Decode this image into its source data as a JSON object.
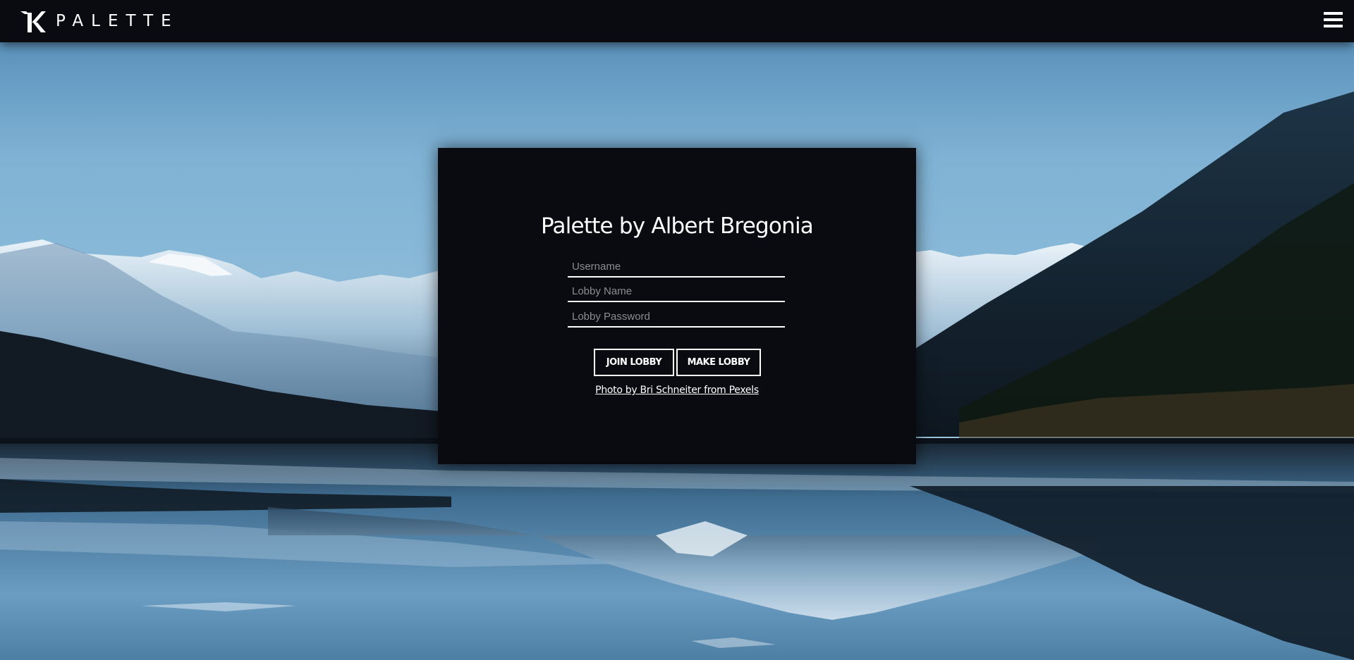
{
  "navbar": {
    "brand_name": "PALETTE",
    "logo_icon": "k-letter-logo-icon",
    "menu_icon": "hamburger-menu-icon"
  },
  "login": {
    "title": "Palette by Albert Bregonia",
    "username_placeholder": "Username",
    "lobby_name_placeholder": "Lobby Name",
    "lobby_password_placeholder": "Lobby Password",
    "join_label": "JOIN LOBBY",
    "make_label": "MAKE LOBBY",
    "photo_credit": "Photo by Bri Schneiter from Pexels"
  },
  "colors": {
    "nav_bg": "#0a0b10",
    "card_bg": "#0a0b10",
    "text": "#ffffff",
    "sky": "#79aed2",
    "lake": "#5d8fb3"
  }
}
